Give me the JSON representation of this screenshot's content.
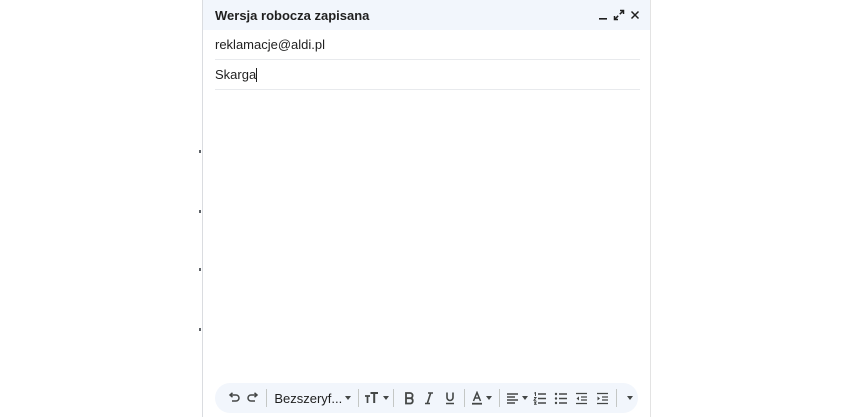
{
  "compose": {
    "title": "Wersja robocza zapisana",
    "recipient": "reklamacje@aldi.pl",
    "subject": "Skarga",
    "body": ""
  },
  "header_icons": [
    "minimize-icon",
    "expand-icon",
    "close-icon"
  ],
  "toolbar": {
    "font_family": "Bezszeryf...",
    "icons": [
      "undo-icon",
      "redo-icon",
      "font-size-icon",
      "bold-icon",
      "italic-icon",
      "underline-icon",
      "text-color-icon",
      "align-icon",
      "numbered-list-icon",
      "bulleted-list-icon",
      "indent-less-icon",
      "indent-more-icon",
      "more-formatting-icon"
    ]
  },
  "colors": {
    "header_bg": "#f2f6fc",
    "toolbar_bg": "#f2f6fc",
    "text": "#1f1f1f",
    "icon": "#444746",
    "divider": "#e8eaed"
  }
}
